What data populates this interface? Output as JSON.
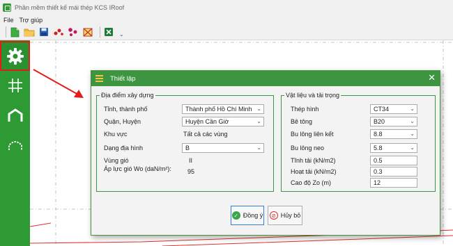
{
  "app": {
    "title": "Phần mềm thiết kế mái thép KCS IRoof"
  },
  "menu": {
    "items": [
      "File",
      "Trợ giúp"
    ]
  },
  "toolbar": {
    "more_glyph": "⌄"
  },
  "dialog": {
    "title": "Thiết lập",
    "close_glyph": "✕",
    "location": {
      "legend": "Địa điểm xây dựng",
      "province_label": "Tỉnh, thành phố",
      "province_value": "Thành phố Hồ Chí Minh",
      "district_label": "Quận, Huyện",
      "district_value": "Huyện Cần Giờ",
      "area_label": "Khu vực",
      "area_value": "Tất cả các vùng",
      "terrain_label": "Dạng địa hình",
      "terrain_value": "B",
      "wind_zone_label": "Vùng gió",
      "wind_zone_value": "II",
      "wind_pressure_label": "Áp lực gió Wo (daN/m²):",
      "wind_pressure_value": "95"
    },
    "material": {
      "legend": "Vật liệu và tải trọng",
      "steel_label": "Thép hình",
      "steel_value": "CT34",
      "concrete_label": "Bê tông",
      "concrete_value": "B20",
      "bolt_label": "Bu lông liên kết",
      "bolt_value": "8.8",
      "anchor_label": "Bu lông neo",
      "anchor_value": "5.8",
      "dead_load_label": "Tĩnh tải (kN/m2)",
      "dead_load_value": "0.5",
      "live_load_label": "Hoạt tải (kN/m2)",
      "live_load_value": "0.3",
      "elevation_label": "Cao độ Zo (m)",
      "elevation_value": "12"
    },
    "buttons": {
      "ok_label": "Đồng ý",
      "cancel_label": "Hủy bỏ"
    }
  },
  "colors": {
    "brand_green": "#2e9a34",
    "highlight_red": "#e21b1b",
    "dialog_header": "#3d9541"
  }
}
